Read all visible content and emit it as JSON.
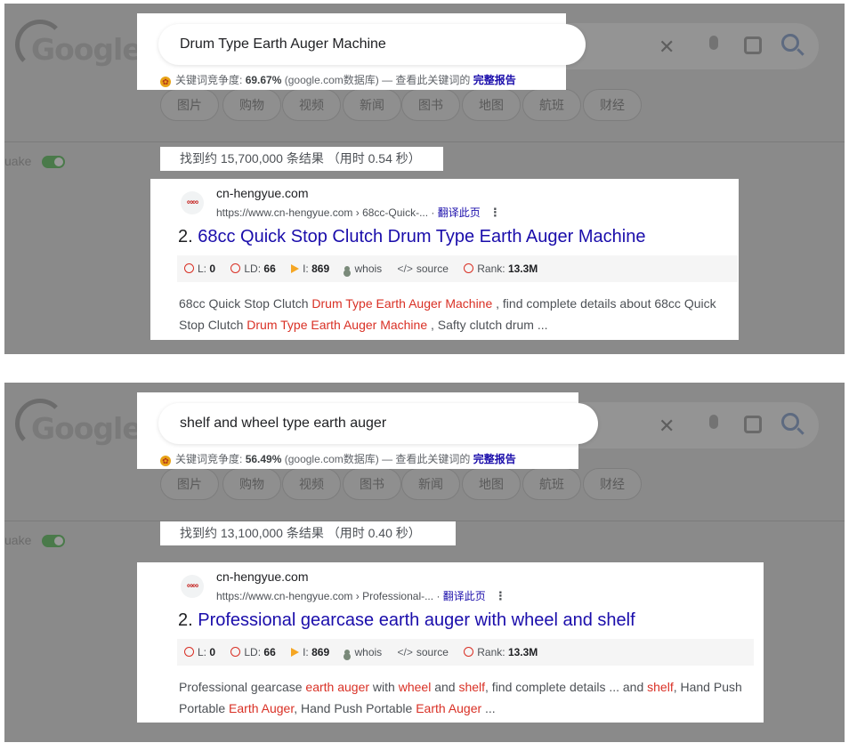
{
  "colors": {
    "highlight": "#d93025",
    "link": "#1a0dab",
    "overlay": "#8a8a8a",
    "toggle": "#4a7a4a"
  },
  "background": {
    "logo": "Google",
    "tabs": [
      "图片",
      "购物",
      "视频",
      "新闻",
      "图书",
      "地图",
      "航班",
      "财经"
    ],
    "tabs_2": [
      "图片",
      "购物",
      "视频",
      "图书",
      "新闻",
      "地图",
      "航班",
      "财经"
    ],
    "side_label": "uake",
    "icons": [
      "close-icon",
      "mic-icon",
      "lens-icon",
      "search-icon"
    ]
  },
  "panels": [
    {
      "query": "Drum Type Earth Auger Machine",
      "kw": {
        "label": "关键词竞争度:",
        "value": "69.67%",
        "db": "(google.com数据库) — 查看此关键词的",
        "report": "完整报告"
      },
      "stats": "找到约 15,700,000 条结果 （用时 0.54 秒）",
      "result": {
        "site": "cn-hengyue.com",
        "url": "https://www.cn-hengyue.com › 68cc-Quick-...",
        "translate": "翻译此页",
        "number": "2.",
        "title": "68cc Quick Stop Clutch Drum Type Earth Auger Machine",
        "metrics": {
          "l": "L: ",
          "l_val": "0",
          "ld": "LD: ",
          "ld_val": "66",
          "i": "I: ",
          "i_val": "869",
          "whois": "whois",
          "source": "source",
          "rank": "Rank: ",
          "rank_val": "13.3M"
        },
        "snippet": [
          {
            "t": "68cc Quick Stop Clutch ",
            "hl": false
          },
          {
            "t": "Drum Type Earth Auger Machine",
            "hl": true
          },
          {
            "t": " , find complete details about 68cc Quick Stop Clutch ",
            "hl": false
          },
          {
            "t": "Drum Type Earth Auger Machine",
            "hl": true
          },
          {
            "t": " , Safty clutch drum ...",
            "hl": false
          }
        ]
      }
    },
    {
      "query": "shelf and wheel type earth auger",
      "kw": {
        "label": "关键词竞争度:",
        "value": "56.49%",
        "db": "(google.com数据库) — 查看此关键词的",
        "report": "完整报告"
      },
      "stats": "找到约 13,100,000 条结果 （用时 0.40 秒）",
      "result": {
        "site": "cn-hengyue.com",
        "url": "https://www.cn-hengyue.com › Professional-...",
        "translate": "翻译此页",
        "number": "2.",
        "title": "Professional gearcase earth auger with wheel and shelf",
        "metrics": {
          "l": "L: ",
          "l_val": "0",
          "ld": "LD: ",
          "ld_val": "66",
          "i": "I: ",
          "i_val": "869",
          "whois": "whois",
          "source": "source",
          "rank": "Rank: ",
          "rank_val": "13.3M"
        },
        "snippet": [
          {
            "t": "Professional gearcase ",
            "hl": false
          },
          {
            "t": "earth auger",
            "hl": true
          },
          {
            "t": " with ",
            "hl": false
          },
          {
            "t": "wheel",
            "hl": true
          },
          {
            "t": " and ",
            "hl": false
          },
          {
            "t": "shelf",
            "hl": true
          },
          {
            "t": ", find complete details ... and ",
            "hl": false
          },
          {
            "t": "shelf",
            "hl": true
          },
          {
            "t": ", Hand Push Portable ",
            "hl": false
          },
          {
            "t": "Earth Auger",
            "hl": true
          },
          {
            "t": ", Hand Push Portable ",
            "hl": false
          },
          {
            "t": "Earth Auger",
            "hl": true
          },
          {
            "t": " ...",
            "hl": false
          }
        ]
      }
    }
  ]
}
